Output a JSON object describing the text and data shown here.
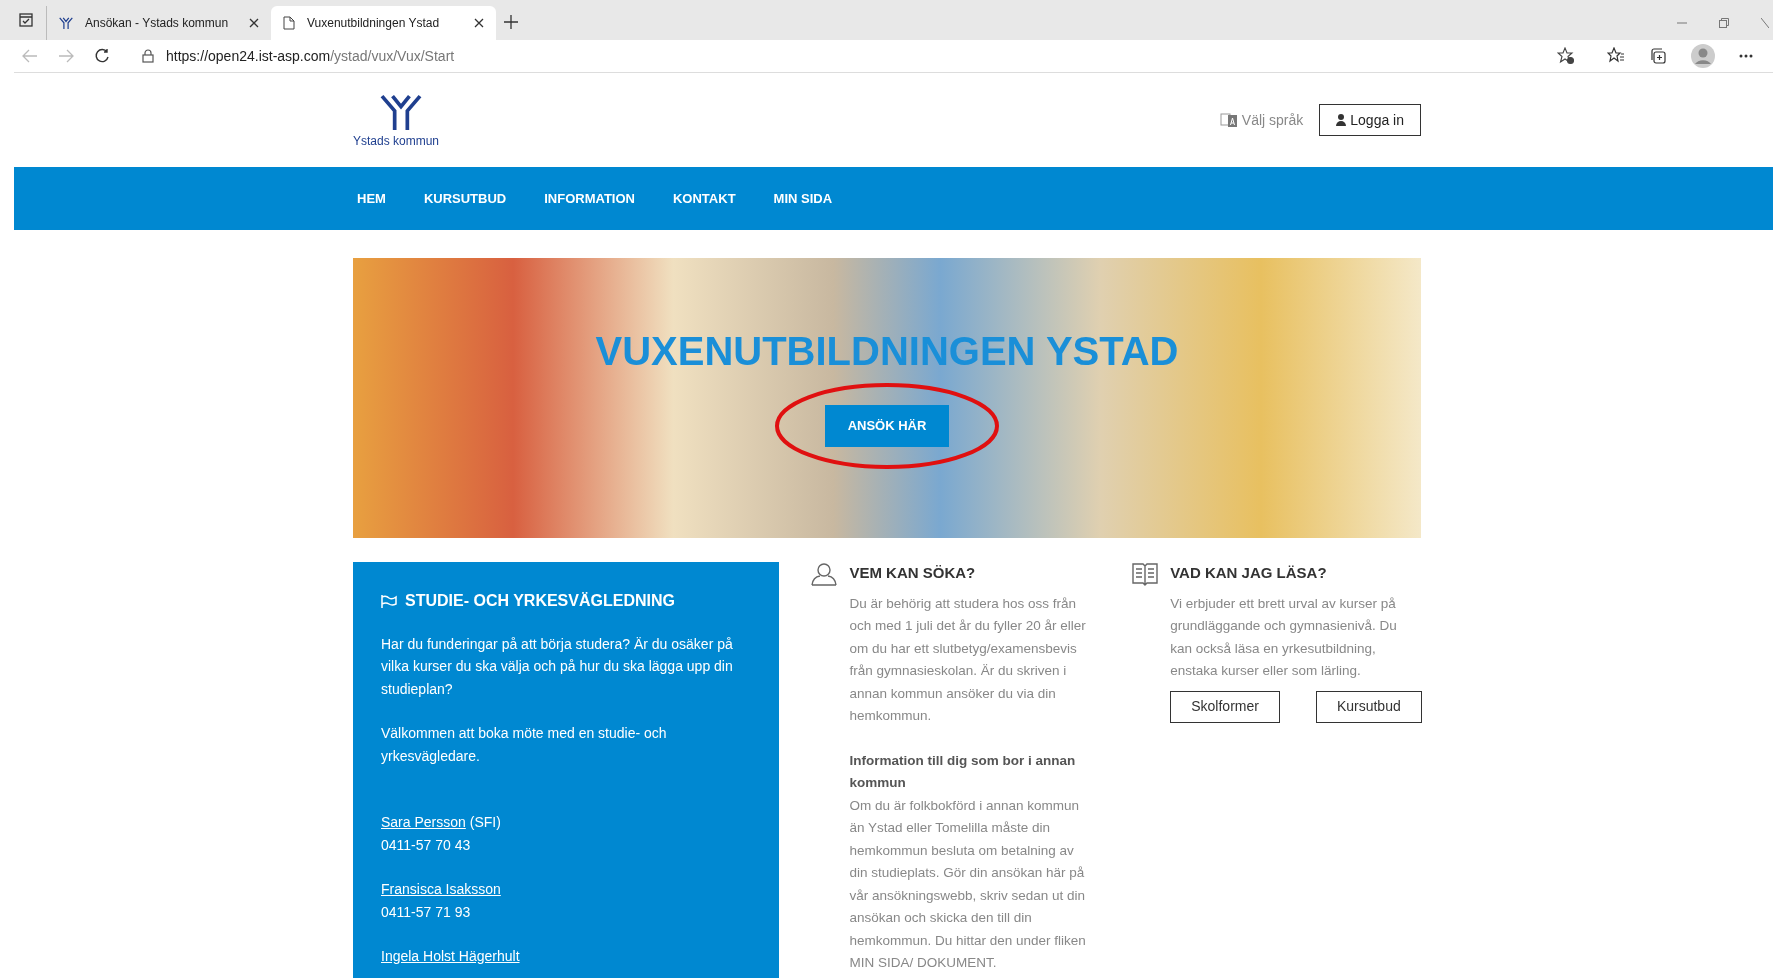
{
  "browser": {
    "tabs": [
      {
        "title": "Ansökan - Ystads kommun",
        "selected": false,
        "kind": "logo"
      },
      {
        "title": "Vuxenutbildningen Ystad",
        "selected": true,
        "kind": "page"
      }
    ],
    "url_host": "https://open24.ist-asp.com",
    "url_path": "/ystad/vux/Vux/Start"
  },
  "header": {
    "logo_text": "Ystads kommun",
    "language": "Välj språk",
    "login": "Logga in"
  },
  "nav": [
    {
      "label": "HEM"
    },
    {
      "label": "KURSUTBUD"
    },
    {
      "label": "INFORMATION"
    },
    {
      "label": "KONTAKT"
    },
    {
      "label": "MIN SIDA"
    }
  ],
  "hero": {
    "title": "VUXENUTBILDNINGEN YSTAD",
    "button": "ANSÖK HÄR",
    "highlighted": true
  },
  "guidance": {
    "title": "STUDIE- OCH YRKESVÄGLEDNING",
    "paragraphs": [
      "Har du funderingar på att börja studera? Är du osäker på vilka kurser du ska välja och på hur du ska lägga upp din studieplan?",
      "Välkommen att boka möte med en studie- och yrkesvägledare."
    ],
    "contacts": [
      {
        "name": "Sara Persson",
        "note": "(SFI)",
        "phone": "0411-57 70 43"
      },
      {
        "name": "Fransisca Isaksson",
        "phone": "0411-57 71 93"
      },
      {
        "name": "Ingela Holst Hägerhult"
      }
    ]
  },
  "who": {
    "title": "VEM KAN SÖKA?",
    "text": "Du är behörig att studera hos oss från och med 1 juli det år du fyller 20 år eller om du har ett slutbetyg/examensbevis från gymnasieskolan. Är du skriven i annan kommun ansöker du via din hemkommun.",
    "subtitle": "Information till dig som bor i annan kommun",
    "subtext": "Om du är folkbokförd i annan kommun än Ystad eller Tomelilla måste din hemkommun besluta om betalning av din studieplats. Gör din ansökan här på vår ansökningswebb, skriv sedan ut din ansökan och skicka den till din hemkommun. Du hittar den under fliken MIN SIDA/ DOKUMENT."
  },
  "what": {
    "title": "VAD KAN JAG LÄSA?",
    "text": "Vi erbjuder ett brett urval av kurser på grundläggande och gymnasienivå. Du kan också läsa en yrkesutbildning, enstaka kurser eller som lärling.",
    "buttons": [
      "Skolformer",
      "Kursutbud"
    ]
  }
}
